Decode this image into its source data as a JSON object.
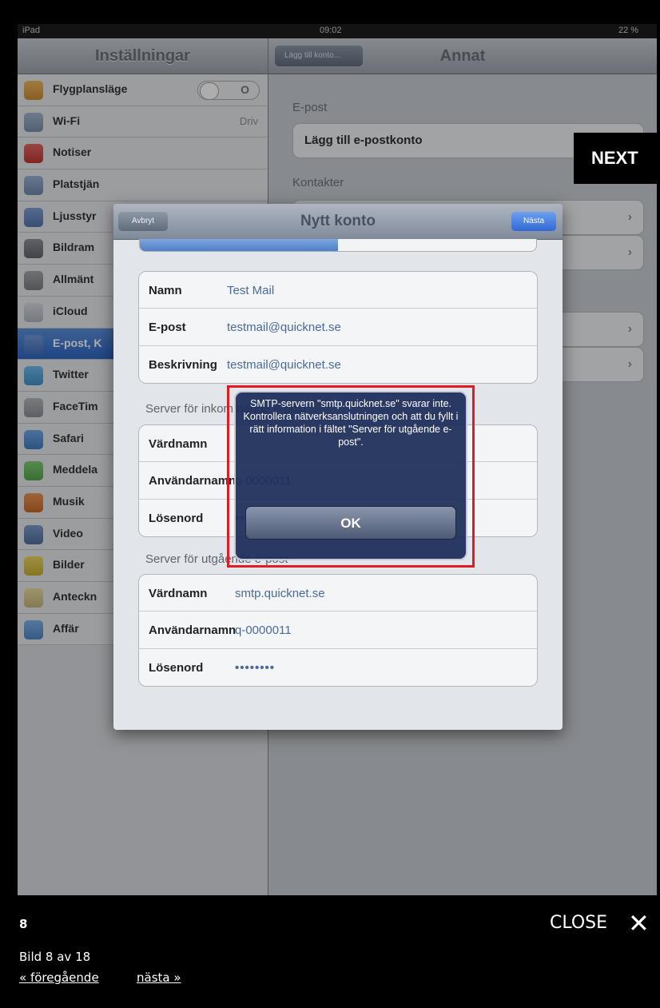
{
  "status_bar": {
    "device": "iPad",
    "time": "09:02",
    "battery": "22 %"
  },
  "sidebar": {
    "title": "Inställningar",
    "items": [
      {
        "label": "Flygplansläge",
        "icon": "airplane-icon",
        "color": "#e8a23a",
        "toggle": "O"
      },
      {
        "label": "Wi-Fi",
        "icon": "wifi-icon",
        "color": "#8aa3c4",
        "value": "Driv"
      },
      {
        "label": "Notiser",
        "icon": "notification-icon",
        "color": "#d8413a"
      },
      {
        "label": "Platstjän",
        "icon": "location-icon",
        "color": "#7f9cc5"
      },
      {
        "label": "Ljusstyr",
        "icon": "brightness-icon",
        "color": "#5f86c7"
      },
      {
        "label": "Bildram",
        "icon": "picture-frame-icon",
        "color": "#6f747b"
      },
      {
        "label": "Allmänt",
        "icon": "gear-icon",
        "color": "#8b9097"
      },
      {
        "label": "iCloud",
        "icon": "cloud-icon",
        "color": "#c9ced6"
      },
      {
        "label": "E-post, K",
        "icon": "mail-icon",
        "color": "#4e7fcf",
        "selected": true
      },
      {
        "label": "Twitter",
        "icon": "twitter-icon",
        "color": "#4aa7e6"
      },
      {
        "label": "FaceTim",
        "icon": "facetime-icon",
        "color": "#9ea3aa"
      },
      {
        "label": "Safari",
        "icon": "safari-icon",
        "color": "#4b8fe0"
      },
      {
        "label": "Meddela",
        "icon": "messages-icon",
        "color": "#5ec053"
      },
      {
        "label": "Musik",
        "icon": "music-icon",
        "color": "#e37a2c"
      },
      {
        "label": "Video",
        "icon": "video-icon",
        "color": "#5b7fb8"
      },
      {
        "label": "Bilder",
        "icon": "photos-icon",
        "color": "#e5c93a"
      },
      {
        "label": "Anteckn",
        "icon": "notes-icon",
        "color": "#e2d08a"
      },
      {
        "label": "Affär",
        "icon": "store-icon",
        "color": "#5c9be0"
      }
    ]
  },
  "right_pane": {
    "back_label": "Lägg till konto...",
    "title": "Annat",
    "section_email": "E-post",
    "add_email_account": "Lägg till e-postkonto",
    "section_contacts": "Kontakter"
  },
  "modal": {
    "cancel_label": "Avbryt",
    "title": "Nytt konto",
    "next_label": "Nästa",
    "progress": 0.5,
    "account": [
      {
        "key": "Namn",
        "value": "Test Mail"
      },
      {
        "key": "E-post",
        "value": "testmail@quicknet.se"
      },
      {
        "key": "Beskrivning",
        "value": "testmail@quicknet.se"
      }
    ],
    "incoming_title": "Server för inkommande e-post",
    "incoming": [
      {
        "key": "Värdnamn",
        "value": ""
      },
      {
        "key": "Användarnamn",
        "value": "q-0000011"
      },
      {
        "key": "Lösenord",
        "value": "••••••••"
      }
    ],
    "outgoing_title": "Server för utgående e-post",
    "outgoing": [
      {
        "key": "Värdnamn",
        "value": "smtp.quicknet.se"
      },
      {
        "key": "Användarnamn",
        "value": "q-0000011"
      },
      {
        "key": "Lösenord",
        "value": "••••••••"
      }
    ]
  },
  "alert": {
    "message": "SMTP-servern \"smtp.quicknet.se\" svarar inte. Kontrollera nätverksanslutningen och att du fyllt i rätt information i fältet \"Server för utgående e-post\".",
    "ok_label": "OK"
  },
  "lightbox": {
    "next_label": "NEXT",
    "slide_number": "8",
    "close_label": "CLOSE",
    "caption": "Bild 8 av 18",
    "prev_link": "« föregående",
    "next_link": "nästa »"
  }
}
